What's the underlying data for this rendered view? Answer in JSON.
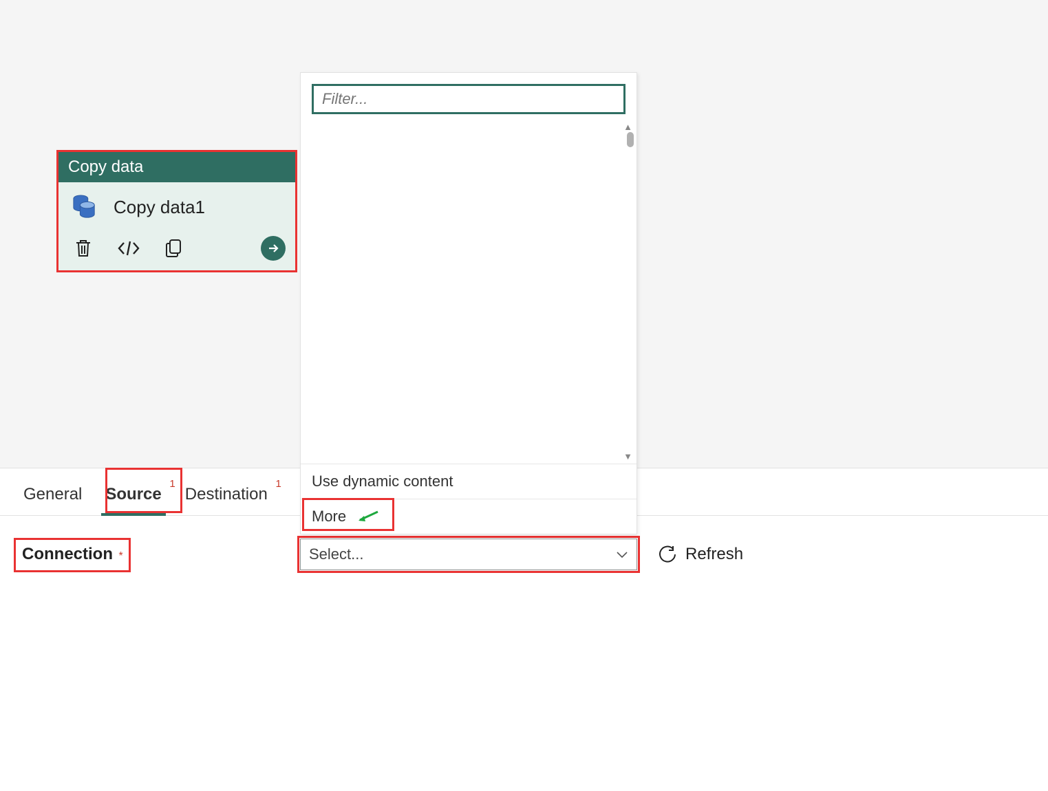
{
  "activity": {
    "header": "Copy data",
    "name": "Copy data1"
  },
  "dropdown": {
    "filter_placeholder": "Filter...",
    "use_dynamic_label": "Use dynamic content",
    "more_label": "More"
  },
  "tabs": {
    "general": "General",
    "source": "Source",
    "source_badge": "1",
    "destination": "Destination",
    "destination_badge": "1"
  },
  "form": {
    "connection_label": "Connection",
    "required_mark": "*",
    "select_placeholder": "Select...",
    "refresh_label": "Refresh"
  }
}
